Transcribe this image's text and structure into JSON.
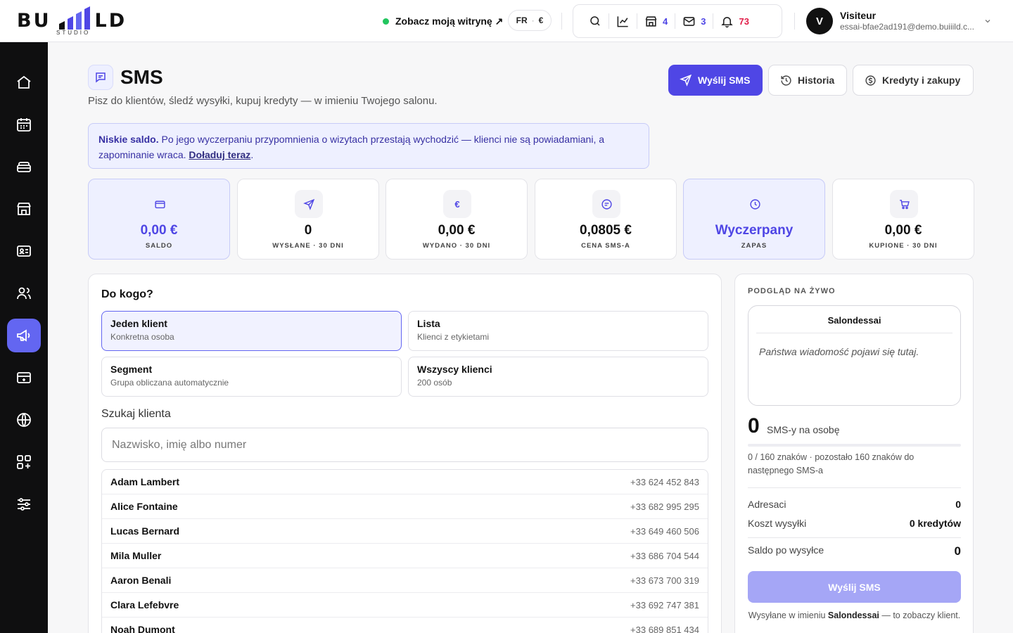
{
  "brand": {
    "name": "BUILD",
    "sub": "STUDIO"
  },
  "topbar": {
    "site_link": "Zobacz moją witrynę ↗",
    "lang": "FR",
    "currency": "€",
    "counts": {
      "shop": "4",
      "mail": "3",
      "bell": "73"
    },
    "user": {
      "initial": "V",
      "name": "Visiteur",
      "email": "essai-bfae2ad191@demo.buiiild.c..."
    }
  },
  "header": {
    "title": "SMS",
    "subtitle": "Pisz do klientów, śledź wysyłki, kupuj kredyty — w imieniu Twojego salonu.",
    "buttons": {
      "send": "Wyślij SMS",
      "history": "Historia",
      "credits": "Kredyty i zakupy"
    }
  },
  "alert": {
    "bold": "Niskie saldo.",
    "text": "Po jego wyczerpaniu przypomnienia o wizytach przestają wychodzić — klienci nie są powiadamiani, a zapominanie wraca.",
    "link": "Doładuj teraz",
    "end": "."
  },
  "stats": [
    {
      "value": "0,00 €",
      "label": "SALDO"
    },
    {
      "value": "0",
      "label": "WYSŁANE · 30 DNI"
    },
    {
      "value": "0,00 €",
      "label": "WYDANO · 30 DNI"
    },
    {
      "value": "0,0805 €",
      "label": "CENA SMS-A"
    },
    {
      "value": "Wyczerpany",
      "label": "ZAPAS"
    },
    {
      "value": "0,00 €",
      "label": "KUPIONE · 30 DNI"
    }
  ],
  "recipients": {
    "title": "Do kogo?",
    "options": [
      {
        "title": "Jeden klient",
        "sub": "Konkretna osoba"
      },
      {
        "title": "Lista",
        "sub": "Klienci z etykietami"
      },
      {
        "title": "Segment",
        "sub": "Grupa obliczana automatycznie"
      },
      {
        "title": "Wszyscy klienci",
        "sub": "200 osób"
      }
    ],
    "search_label": "Szukaj klienta",
    "search_placeholder": "Nazwisko, imię albo numer",
    "clients": [
      {
        "name": "Adam Lambert",
        "phone": "+33 624 452 843"
      },
      {
        "name": "Alice Fontaine",
        "phone": "+33 682 995 295"
      },
      {
        "name": "Lucas Bernard",
        "phone": "+33 649 460 506"
      },
      {
        "name": "Mila Muller",
        "phone": "+33 686 704 544"
      },
      {
        "name": "Aaron Benali",
        "phone": "+33 673 700 319"
      },
      {
        "name": "Clara Lefebvre",
        "phone": "+33 692 747 381"
      },
      {
        "name": "Noah Dumont",
        "phone": "+33 689 851 434"
      }
    ]
  },
  "preview": {
    "label": "PODGLĄD NA ŻYWO",
    "sender": "Salondessai",
    "placeholder": "Państwa wiadomość pojawi się tutaj.",
    "sms_count": "0",
    "sms_unit": "SMS-y na osobę",
    "progress": 0,
    "chars": "0 / 160 znaków · pozostało 160 znaków do następnego SMS-a",
    "recipients_label": "Adresaci",
    "recipients_value": "0",
    "cost_label": "Koszt wysyłki",
    "cost_value": "0 kredytów",
    "balance_label": "Saldo po wysyłce",
    "balance_value": "0",
    "send": "Wyślij SMS",
    "foot_pre": "Wysyłane w imieniu",
    "foot_name": "Salondessai",
    "foot_post": "— to zobaczy klient."
  },
  "colors": {
    "accent": "#4f46e5",
    "sidebar": "#0f0f10",
    "alert_bg": "#eef0ff",
    "danger": "#e11d48",
    "online": "#22c55e"
  },
  "sidebar_icons": [
    "home-icon",
    "calendar-icon",
    "services-icon",
    "shop-icon",
    "id-card-icon",
    "clients-icon",
    "megaphone-icon",
    "payment-icon",
    "globe-icon",
    "apps-icon",
    "sliders-icon"
  ]
}
